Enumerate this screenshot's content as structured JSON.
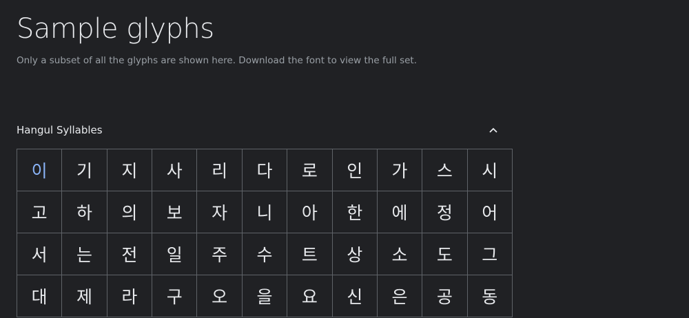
{
  "header": {
    "title": "Sample glyphs",
    "subtitle": "Only a subset of all the glyphs are shown here. Download the font to view the full set."
  },
  "section": {
    "title": "Hangul Syllables",
    "toggle_icon": "chevron-up-icon",
    "expanded": true
  },
  "colors": {
    "background": "#202124",
    "text": "#e8eaed",
    "muted": "#9aa0a6",
    "border": "#5f6368",
    "selected": "#8ab4f8"
  },
  "glyphs": {
    "selected_index": 0,
    "items": [
      "이",
      "기",
      "지",
      "사",
      "리",
      "다",
      "로",
      "인",
      "가",
      "스",
      "시",
      "고",
      "하",
      "의",
      "보",
      "자",
      "니",
      "아",
      "한",
      "에",
      "정",
      "어",
      "서",
      "는",
      "전",
      "일",
      "주",
      "수",
      "트",
      "상",
      "소",
      "도",
      "그",
      "대",
      "제",
      "라",
      "구",
      "오",
      "을",
      "요",
      "신",
      "은",
      "공",
      "동"
    ]
  }
}
